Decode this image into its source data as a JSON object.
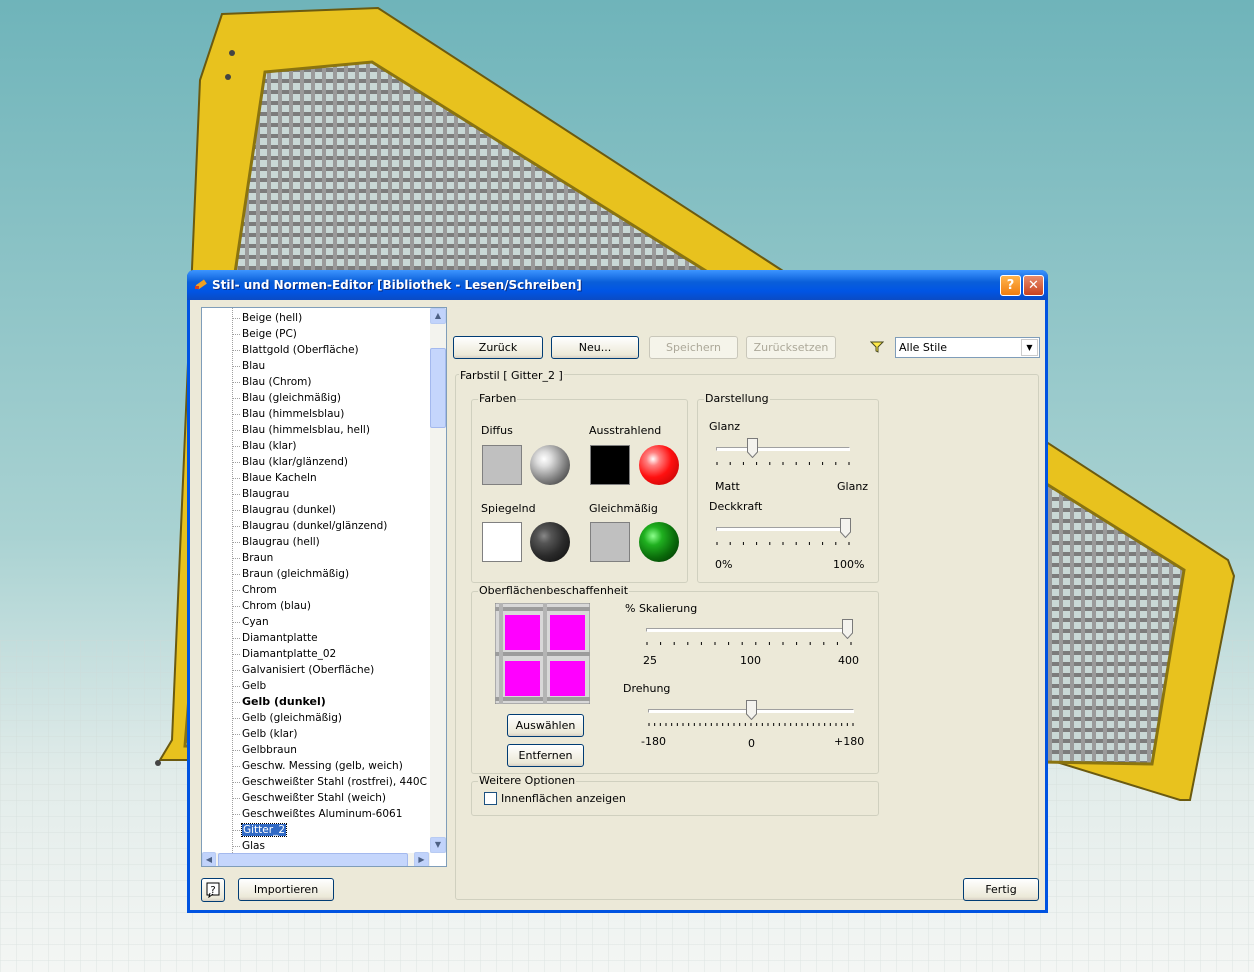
{
  "dialog": {
    "title": "Stil- und Normen-Editor [Bibliothek - Lesen/Schreiben]",
    "help_glyph": "?",
    "close_glyph": "✕"
  },
  "tree": {
    "items": [
      {
        "label": "Beige (hell)"
      },
      {
        "label": "Beige (PC)"
      },
      {
        "label": "Blattgold (Oberfläche)"
      },
      {
        "label": "Blau"
      },
      {
        "label": "Blau (Chrom)"
      },
      {
        "label": "Blau (gleichmäßig)"
      },
      {
        "label": "Blau (himmelsblau)"
      },
      {
        "label": "Blau (himmelsblau, hell)"
      },
      {
        "label": "Blau (klar)"
      },
      {
        "label": "Blau (klar/glänzend)"
      },
      {
        "label": "Blaue Kacheln"
      },
      {
        "label": "Blaugrau"
      },
      {
        "label": "Blaugrau (dunkel)"
      },
      {
        "label": "Blaugrau (dunkel/glänzend)"
      },
      {
        "label": "Blaugrau (hell)"
      },
      {
        "label": "Braun"
      },
      {
        "label": "Braun (gleichmäßig)"
      },
      {
        "label": "Chrom"
      },
      {
        "label": "Chrom (blau)"
      },
      {
        "label": "Cyan"
      },
      {
        "label": "Diamantplatte"
      },
      {
        "label": "Diamantplatte_02"
      },
      {
        "label": "Galvanisiert (Oberfläche)"
      },
      {
        "label": "Gelb"
      },
      {
        "label": "Gelb (dunkel)"
      },
      {
        "label": "Gelb (gleichmäßig)"
      },
      {
        "label": "Gelb (klar)"
      },
      {
        "label": "Gelbbraun"
      },
      {
        "label": "Geschw. Messing (gelb, weich)"
      },
      {
        "label": "Geschweißter Stahl (rostfrei), 440C"
      },
      {
        "label": "Geschweißter Stahl (weich)"
      },
      {
        "label": "Geschweißtes Aluminum-6061"
      },
      {
        "label": "Gitter_2"
      },
      {
        "label": "Glas"
      }
    ],
    "active_item": "Gelb (dunkel)",
    "selected_item": "Gitter_2"
  },
  "toolbar": {
    "back_label": "Zurück",
    "new_label": "Neu...",
    "save_label": "Speichern",
    "reset_label": "Zurücksetzen",
    "filter_value": "Alle Stile",
    "filter_icon": "funnel-icon"
  },
  "style_panel": {
    "title": "Farbstil [ Gitter_2 ]",
    "colors": {
      "group_label": "Farben",
      "diffuse_label": "Diffus",
      "emissive_label": "Ausstrahlend",
      "specular_label": "Spiegelnd",
      "ambient_label": "Gleichmäßig",
      "diffuse_color": "#c0c0c0",
      "emissive_color": "#000000",
      "specular_color": "#ffffff",
      "ambient_color": "#c0c0c0"
    },
    "appearance": {
      "group_label": "Darstellung",
      "gloss_label": "Glanz",
      "gloss_min_label": "Matt",
      "gloss_max_label": "Glanz",
      "gloss_value": 0.25,
      "opacity_label": "Deckkraft",
      "opacity_min_label": "0%",
      "opacity_max_label": "100%",
      "opacity_value": 1.0
    },
    "texture": {
      "group_label": "Oberflächenbeschaffenheit",
      "texture_color": "#ff00ff",
      "select_label": "Auswählen",
      "remove_label": "Entfernen",
      "scale_label": "% Skalierung",
      "scale_min_label": "25",
      "scale_mid_label": "100",
      "scale_max_label": "400",
      "scale_value": 400,
      "rotation_label": "Drehung",
      "rotation_min_label": "-180",
      "rotation_mid_label": "0",
      "rotation_max_label": "+180",
      "rotation_value": 0
    },
    "options": {
      "group_label": "Weitere Optionen",
      "inner_faces_label": "Innenflächen anzeigen",
      "inner_faces_checked": false
    }
  },
  "footer": {
    "help_icon": "help-icon",
    "import_label": "Importieren",
    "done_label": "Fertig"
  }
}
